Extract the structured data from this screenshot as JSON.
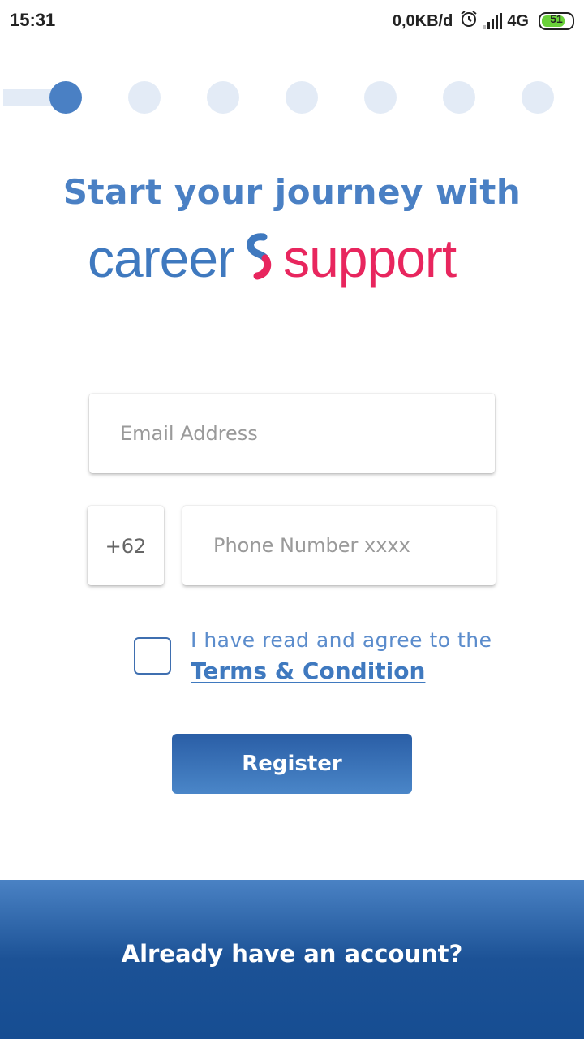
{
  "status_bar": {
    "time": "15:31",
    "network_speed": "0,0KB/d",
    "network_type": "4G",
    "battery": "51",
    "icons": [
      "alarm-icon",
      "signal-icon",
      "battery-icon"
    ]
  },
  "stepper": {
    "total_steps": 7,
    "current_step": 1,
    "active_color": "#4a80c4",
    "inactive_color": "#e3ebf6"
  },
  "header": {
    "headline": "Start your journey with",
    "brand_left": "career",
    "brand_right": "support",
    "brand_left_color": "#3f79bf",
    "brand_right_color": "#e8265e"
  },
  "form": {
    "email_placeholder": "Email Address",
    "country_code": "+62",
    "phone_placeholder": "Phone Number xxxx",
    "agree_text": "I have read and agree to the",
    "terms_link": "Terms & Condition",
    "register_label": "Register"
  },
  "footer": {
    "login_prompt": "Already have an account?"
  }
}
